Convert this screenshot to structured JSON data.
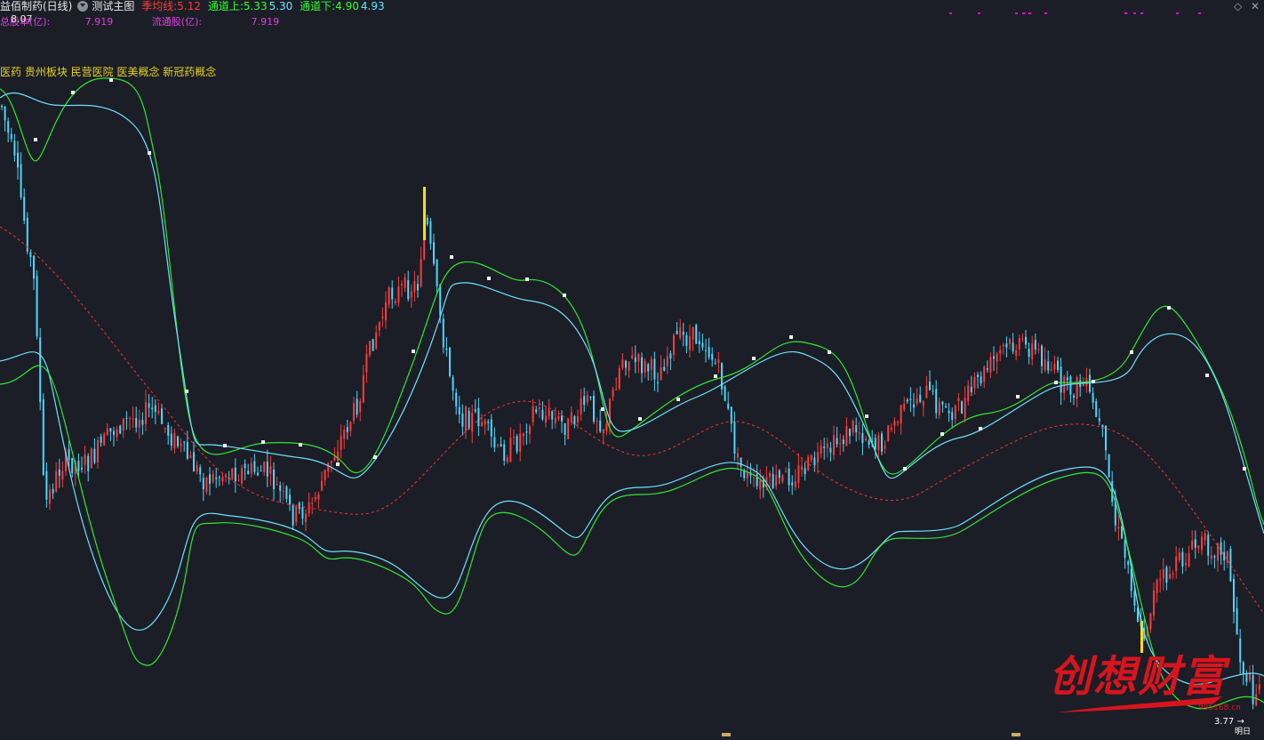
{
  "header": {
    "stock_title": "益佰制药(日线)",
    "indicator_name": "测试主图",
    "ma_label": "季均线:",
    "ma_value": "5.12",
    "upper_label": "通道上:",
    "upper_value1": "5.33",
    "upper_value2": "5.30",
    "lower_label": "通道下:",
    "lower_value1": "4.90",
    "lower_value2": "4.93",
    "price_overlay": "8.07"
  },
  "info_row": {
    "total_label": "总股本(亿):",
    "total_value": "7.919",
    "float_label": "流通股(亿):",
    "float_value": "7.919"
  },
  "concepts": "医药 贵州板块 民营医院 医美概念 新冠药概念",
  "low_price": "3.77",
  "bottom_badge": "明日",
  "watermark": {
    "text": "创想财富",
    "url": "995168.cn"
  },
  "icons": {
    "dropdown": "chevron-down-icon",
    "diamond": "diamond-icon",
    "close": "close-icon"
  },
  "colors": {
    "background": "#1b1e26",
    "title": "#e8e8e8",
    "ma_red": "#ff3b3b",
    "up_green": "#33ff33",
    "cyan": "#66e6ff",
    "magenta": "#ff44ff",
    "yellow": "#ffe100",
    "candle_up": "#ff3b3b",
    "candle_down": "#4fd6ff",
    "signal_marker": "#ff00ff"
  }
}
